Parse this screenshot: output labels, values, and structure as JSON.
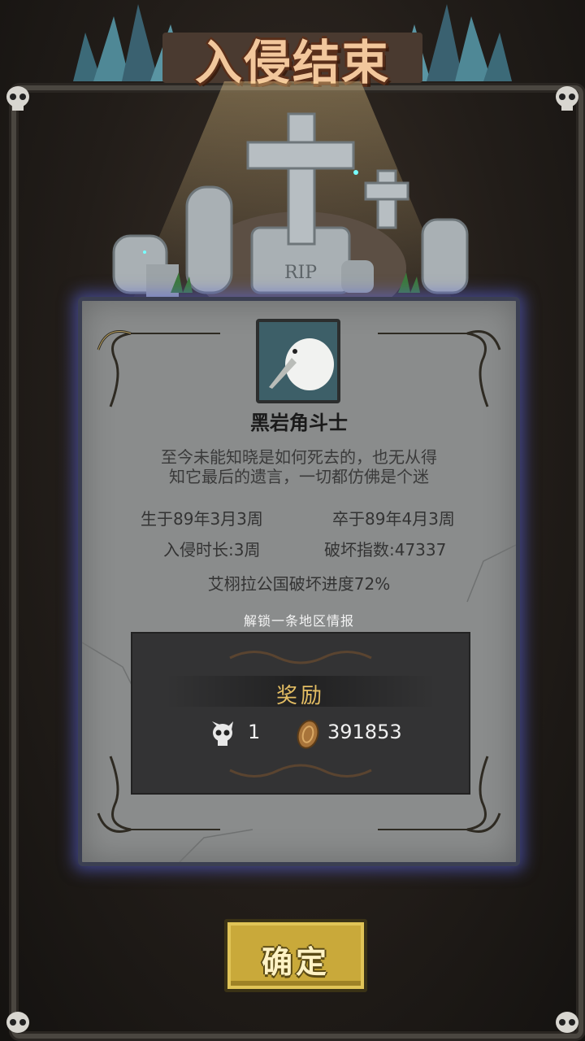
{
  "title": "入侵结束",
  "hero": {
    "name": "黑岩角斗士",
    "description_line1": "至今未能知晓是如何死去的，也无从得",
    "description_line2": "知它最后的遗言，一切都仿佛是个迷",
    "tombstone_text": "RIP"
  },
  "stats": {
    "born": "生于89年3月3周",
    "died": "卒于89年4月3周",
    "duration": "入侵时长:3周",
    "destruction": "破坏指数:47337",
    "progress": "艾栩拉公国破坏进度72%"
  },
  "unlock_text": "解锁一条地区情报",
  "reward": {
    "title": "奖励",
    "skull_count": "1",
    "coin_count": "391853"
  },
  "confirm_label": "确定",
  "colors": {
    "title": "#f2c79c",
    "panel": "#8a8c8c",
    "panel_glow": "#5a64dc",
    "reward_title": "#e3bd63",
    "button": "#c9a93a"
  }
}
